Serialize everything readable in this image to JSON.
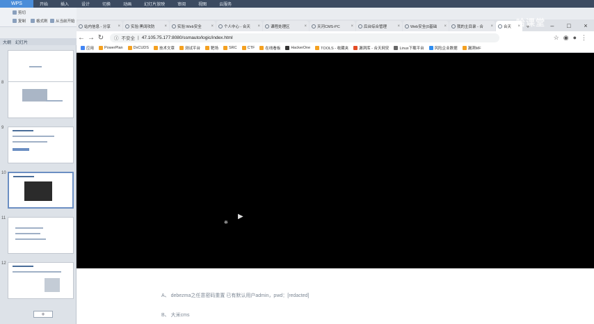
{
  "ribbon": {
    "app_label": "WPS",
    "menu": [
      "开始",
      "插入",
      "设计",
      "切换",
      "动画",
      "幻灯片放映",
      "审阅",
      "视图",
      "云服务"
    ],
    "tools": [
      "剪切",
      "复制",
      "格式刷",
      "从当前开始"
    ]
  },
  "panel": {
    "tab_outline": "大纲",
    "tab_slides": "幻灯片",
    "slide_numbers": [
      "",
      "8",
      "9",
      "10",
      "11",
      "12"
    ],
    "add_label": "+"
  },
  "browser": {
    "tabs": [
      {
        "label": "站内信息 - 分享",
        "icon": "shield-icon"
      },
      {
        "label": "实验:黑阔攻防",
        "icon": "shield-icon"
      },
      {
        "label": "实验:Web安全",
        "icon": "shield-icon"
      },
      {
        "label": "个人中心 - 合天",
        "icon": "shield-icon"
      },
      {
        "label": "课程处理区",
        "icon": "shield-icon"
      },
      {
        "label": "天河CMS-PC",
        "icon": "shield-icon"
      },
      {
        "label": "后台综合管理",
        "icon": "shield-icon"
      },
      {
        "label": "Web安全(0基础",
        "icon": "shield-icon"
      },
      {
        "label": "我的主目录 - 合",
        "icon": "shield-icon"
      },
      {
        "label": "合天",
        "icon": "shield-icon"
      }
    ],
    "new_tab": "+",
    "window_controls": [
      "–",
      "□",
      "×"
    ],
    "security_label": "不安全",
    "url": "47.105.75.177:8080/ssmauto/logic/index.html",
    "bookmarks": [
      "应用",
      "PowerPlan",
      "DxCUDS",
      "技术文章",
      "测试平台",
      "靶场",
      "SRC",
      "CTF",
      "在线看板",
      "HackerOne",
      "TOOLS - 收藏夹",
      "漏洞库 - 合天网安",
      "Linux下载平台",
      "风险企业数据",
      "漏洞MF"
    ]
  },
  "slide": {
    "option_a": "A、 debezma之任意密码重置 已有默认用户admin，pwd：[redacted]",
    "option_b": "B、 大米cms"
  },
  "watermark": "哈课堂"
}
